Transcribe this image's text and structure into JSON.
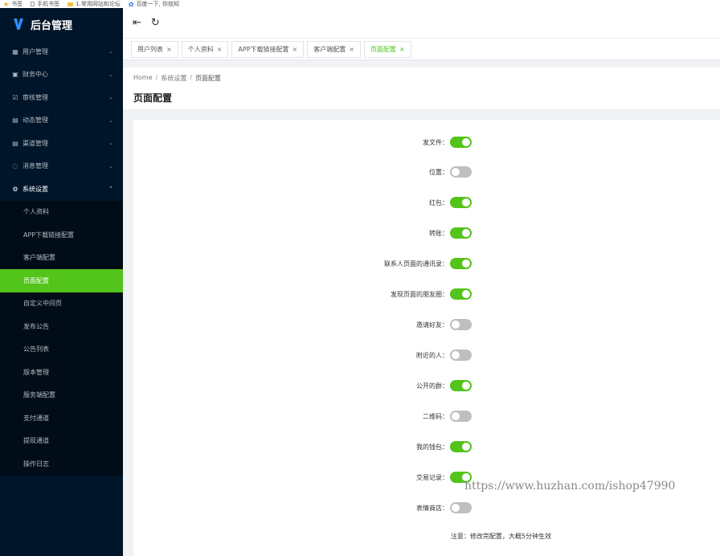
{
  "bookmarks": [
    "书签",
    "手机书签",
    "1.常用网站和论坛",
    "百度一下, 你就知"
  ],
  "sidebar": {
    "title": "后台管理",
    "menu": [
      {
        "icon": "grid-icon",
        "glyph": "▦",
        "label": "用户管理"
      },
      {
        "icon": "finance-icon",
        "glyph": "▣",
        "label": "财务中心"
      },
      {
        "icon": "check-icon",
        "glyph": "☑",
        "label": "审核管理"
      },
      {
        "icon": "doc-icon",
        "glyph": "▤",
        "label": "动态管理"
      },
      {
        "icon": "doc-icon",
        "glyph": "▤",
        "label": "渠道管理"
      },
      {
        "icon": "message-icon",
        "glyph": "◌",
        "label": "消息管理"
      },
      {
        "icon": "gear-icon",
        "glyph": "⚙",
        "label": "系统设置"
      }
    ],
    "submenu": [
      "个人资料",
      "APP下载链接配置",
      "客户端配置",
      "页面配置",
      "自定义中间页",
      "发布公告",
      "公告列表",
      "版本管理",
      "服务端配置",
      "支付通道",
      "提现通道",
      "操作日志"
    ]
  },
  "tabs": [
    {
      "label": "用户列表"
    },
    {
      "label": "个人资料"
    },
    {
      "label": "APP下载链接配置"
    },
    {
      "label": "客户端配置"
    },
    {
      "label": "页面配置"
    }
  ],
  "breadcrumb": {
    "home": "Home",
    "level1": "系统设置",
    "current": "页面配置"
  },
  "page_title": "页面配置",
  "settings": [
    {
      "label": "发文件",
      "on": true
    },
    {
      "label": "位置",
      "on": false
    },
    {
      "label": "红包",
      "on": true
    },
    {
      "label": "转账",
      "on": true
    },
    {
      "label": "联系人页面的通讯录",
      "on": true
    },
    {
      "label": "发现页面的朋友圈",
      "on": true
    },
    {
      "label": "邀请好友",
      "on": false
    },
    {
      "label": "附近的人",
      "on": false
    },
    {
      "label": "公开的群",
      "on": true
    },
    {
      "label": "二维码",
      "on": false
    },
    {
      "label": "我的钱包",
      "on": true
    },
    {
      "label": "交易记录",
      "on": true
    },
    {
      "label": "表情商店",
      "on": false
    }
  ],
  "label_suffix": "：",
  "note": "注意：修改完配置，大概5分钟生效",
  "watermark": "https://www.huzhan.com/ishop47990",
  "colors": {
    "accent": "#52c41a",
    "sidebar_bg": "#001529",
    "switch_off": "#bfbfbf"
  }
}
